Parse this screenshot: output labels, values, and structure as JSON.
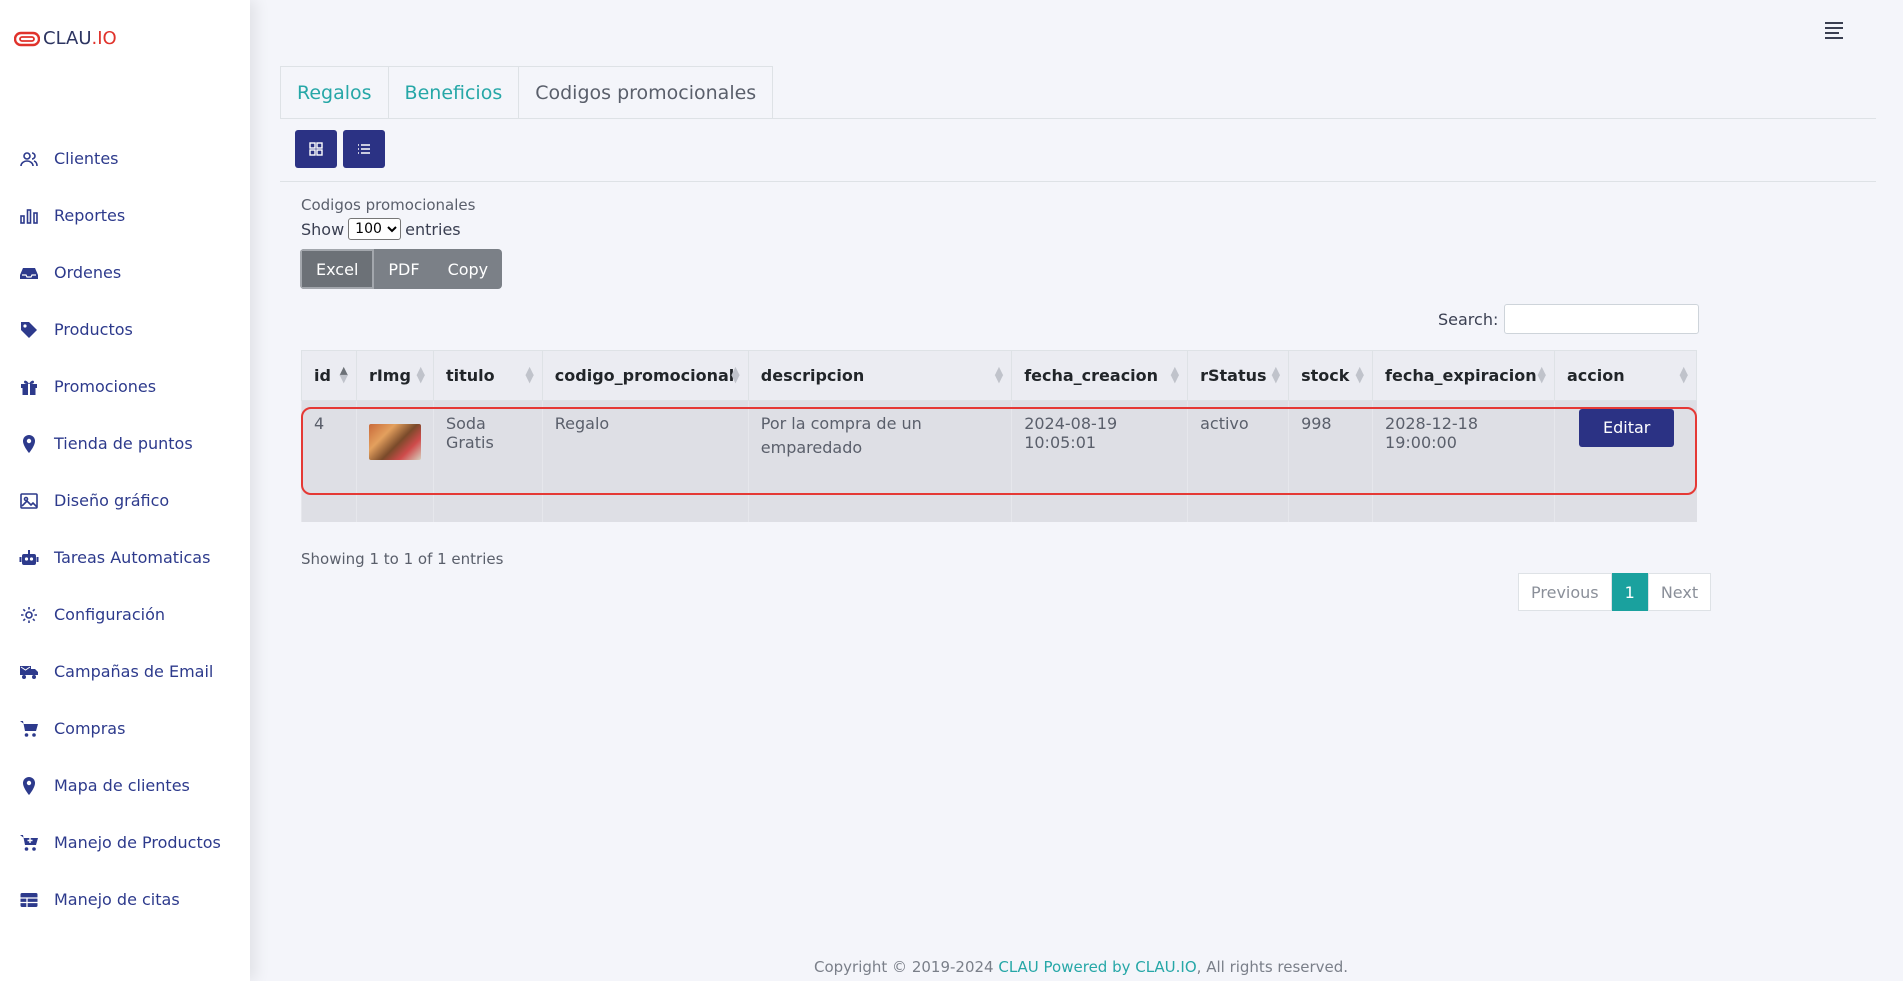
{
  "brand": {
    "logo_a": "CLAU",
    "logo_b": ".IO"
  },
  "sidebar": {
    "items": [
      {
        "label": "Clientes",
        "icon": "users-icon"
      },
      {
        "label": "Reportes",
        "icon": "chart-icon"
      },
      {
        "label": "Ordenes",
        "icon": "inbox-icon"
      },
      {
        "label": "Productos",
        "icon": "tag-icon"
      },
      {
        "label": "Promociones",
        "icon": "gift-icon"
      },
      {
        "label": "Tienda de puntos",
        "icon": "location-pin-icon"
      },
      {
        "label": "Diseño gráfico",
        "icon": "image-icon"
      },
      {
        "label": "Tareas Automaticas",
        "icon": "robot-icon"
      },
      {
        "label": "Configuración",
        "icon": "gear-icon"
      },
      {
        "label": "Campañas de Email",
        "icon": "email-truck-icon"
      },
      {
        "label": "Compras",
        "icon": "cart-icon"
      },
      {
        "label": "Mapa de clientes",
        "icon": "location-pin-icon"
      },
      {
        "label": "Manejo de Productos",
        "icon": "cart-plus-icon"
      },
      {
        "label": "Manejo de citas",
        "icon": "table-icon"
      }
    ]
  },
  "tabs": [
    {
      "label": "Regalos"
    },
    {
      "label": "Beneficios"
    },
    {
      "label": "Codigos promocionales"
    }
  ],
  "section": {
    "title": "Codigos promocionales",
    "show_label": "Show",
    "entries_value": "100",
    "entries_label": "entries",
    "export": {
      "excel": "Excel",
      "pdf": "PDF",
      "copy": "Copy"
    },
    "search_label": "Search:",
    "search_value": ""
  },
  "table": {
    "columns": [
      "id",
      "rImg",
      "titulo",
      "codigo_promocional",
      "descripcion",
      "fecha_creacion",
      "rStatus",
      "stock",
      "fecha_expiracion",
      "accion"
    ],
    "rows": [
      {
        "id": "4",
        "titulo": "Soda Gratis",
        "codigo_promocional": "Regalo",
        "descripcion": "Por la compra de un emparedado",
        "fecha_creacion": "2024-08-19 10:05:01",
        "rStatus": "activo",
        "stock": "998",
        "fecha_expiracion": "2028-12-18 19:00:00",
        "accion": "Editar"
      }
    ]
  },
  "info": {
    "showing": "Showing 1 to 1 of 1 entries"
  },
  "pagination": {
    "previous": "Previous",
    "current": "1",
    "next": "Next"
  },
  "footer": {
    "prefix": "Copyright © 2019-2024 ",
    "link": "CLAU Powered by CLAU.IO",
    "suffix": ", All rights reserved."
  },
  "colors": {
    "primary": "#2b3284",
    "accent": "#26a7a7",
    "highlight": "#e53935"
  }
}
